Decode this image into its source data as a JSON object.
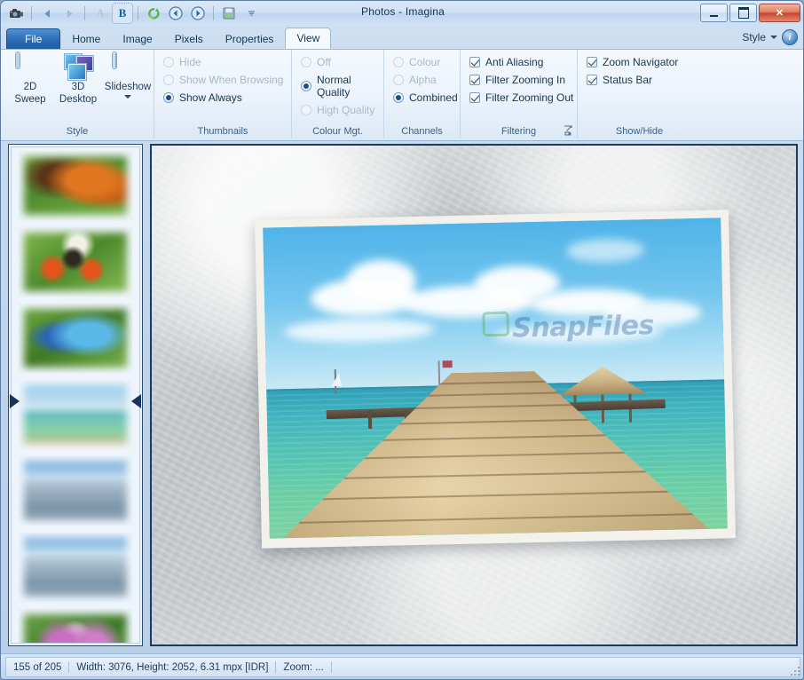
{
  "window": {
    "title": "Photos - Imagina",
    "controls": {
      "minimize": "minimize-button",
      "maximize": "maximize-button",
      "close": "✕"
    }
  },
  "quick_access": {
    "items": [
      {
        "name": "camera-icon",
        "glyph": "❖"
      },
      {
        "name": "previous-icon",
        "glyph": "◀"
      },
      {
        "name": "next-icon",
        "glyph": "▶"
      },
      {
        "name": "text-a-icon",
        "glyph": "A"
      },
      {
        "name": "text-b-icon",
        "glyph": "B"
      },
      {
        "name": "refresh-icon",
        "glyph": "⟳"
      },
      {
        "name": "back-icon",
        "glyph": "←"
      },
      {
        "name": "forward-icon",
        "glyph": "→"
      },
      {
        "name": "save-icon",
        "glyph": "▤"
      },
      {
        "name": "customize-icon",
        "glyph": "▾"
      }
    ]
  },
  "tabs": {
    "file": "File",
    "items": [
      "Home",
      "Image",
      "Pixels",
      "Properties",
      "View"
    ],
    "active": "View"
  },
  "header_right": {
    "style_label": "Style",
    "info_glyph": "i"
  },
  "ribbon": {
    "groups": [
      {
        "title": "Style",
        "buttons": [
          {
            "line1": "2D",
            "line2": "Sweep",
            "icon": "monitor-icon",
            "has_caret": false
          },
          {
            "line1": "3D",
            "line2": "Desktop",
            "icon": "stack-icon",
            "has_caret": false
          },
          {
            "line1": "Slideshow",
            "line2": "",
            "icon": "slideshow-icon",
            "has_caret": true
          }
        ]
      },
      {
        "title": "Thumbnails",
        "options": [
          {
            "label": "Hide",
            "type": "radio",
            "checked": false,
            "disabled": true
          },
          {
            "label": "Show When Browsing",
            "type": "radio",
            "checked": false,
            "disabled": true
          },
          {
            "label": "Show Always",
            "type": "radio",
            "checked": true,
            "disabled": false
          }
        ]
      },
      {
        "title": "Colour Mgt.",
        "options": [
          {
            "label": "Off",
            "type": "radio",
            "checked": false,
            "disabled": true
          },
          {
            "label": "Normal Quality",
            "type": "radio",
            "checked": true,
            "disabled": false
          },
          {
            "label": "High Quality",
            "type": "radio",
            "checked": false,
            "disabled": true
          }
        ]
      },
      {
        "title": "Channels",
        "options": [
          {
            "label": "Colour",
            "type": "radio",
            "checked": false,
            "disabled": true
          },
          {
            "label": "Alpha",
            "type": "radio",
            "checked": false,
            "disabled": true
          },
          {
            "label": "Combined",
            "type": "radio",
            "checked": true,
            "disabled": false
          }
        ]
      },
      {
        "title": "Filtering",
        "has_dialog_launcher": true,
        "options": [
          {
            "label": "Anti Aliasing",
            "type": "check",
            "checked": true,
            "disabled": false
          },
          {
            "label": "Filter Zooming In",
            "type": "check",
            "checked": true,
            "disabled": false
          },
          {
            "label": "Filter Zooming Out",
            "type": "check",
            "checked": true,
            "disabled": false
          }
        ]
      },
      {
        "title": "Show/Hide",
        "options": [
          {
            "label": "Zoom Navigator",
            "type": "check",
            "checked": true,
            "disabled": false
          },
          {
            "label": "Status Bar",
            "type": "check",
            "checked": true,
            "disabled": false
          }
        ]
      }
    ]
  },
  "thumbnails": {
    "selected_index": 3,
    "items": [
      {
        "name": "thumbnail-orange-butterfly"
      },
      {
        "name": "thumbnail-butterfly-on-flowers"
      },
      {
        "name": "thumbnail-blue-morpho-butterfly"
      },
      {
        "name": "thumbnail-pier-seascape"
      },
      {
        "name": "thumbnail-harbour-sailboats-1"
      },
      {
        "name": "thumbnail-harbour-sailboats-2"
      },
      {
        "name": "thumbnail-purple-orchid"
      }
    ]
  },
  "viewer": {
    "photo_name": "wooden-pier-tropical-sea",
    "watermark": "SnapFiles"
  },
  "statusbar": {
    "position": "155 of 205",
    "dimensions": "Width: 3076, Height: 2052, 6.31 mpx [IDR]",
    "zoom": "Zoom: ..."
  },
  "colors": {
    "accent": "#1f5ca6",
    "titlebar_text": "#13314f",
    "close_button": "#c4442c",
    "selection_marker": "#17355c"
  }
}
